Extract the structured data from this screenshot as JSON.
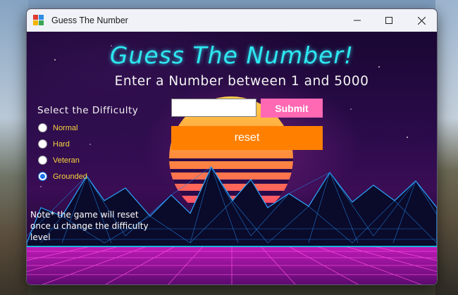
{
  "window": {
    "title": "Guess The Number"
  },
  "game": {
    "heading": "Guess The Number!",
    "instruction": "Enter a Number between 1 and 5000",
    "difficulty_label": "Select the Difficulty",
    "difficulties": [
      {
        "label": "Normal",
        "checked": false
      },
      {
        "label": "Hard",
        "checked": false
      },
      {
        "label": "Veteran",
        "checked": false
      },
      {
        "label": "Grounded",
        "checked": true
      }
    ],
    "guess_value": "",
    "submit_label": "Submit",
    "reset_label": "reset",
    "note": "Note* the game will reset once u change the difficulty level"
  },
  "colors": {
    "heading": "#2ee8f2",
    "submit_bg": "#ff69b4",
    "reset_bg": "#ff8000",
    "radio_text": "#f7d23c",
    "accent": "#1a73e8"
  },
  "icons": {
    "app": "app-grid-icon",
    "minimize": "minimize-icon",
    "maximize": "maximize-icon",
    "close": "close-icon"
  }
}
